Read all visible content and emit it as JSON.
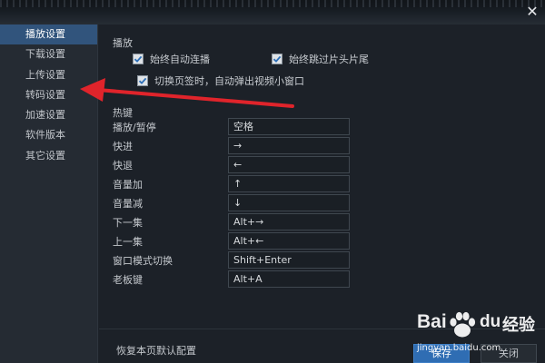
{
  "window": {
    "close_icon": "close-icon"
  },
  "sidebar": {
    "items": [
      {
        "label": "播放设置",
        "active": true
      },
      {
        "label": "下载设置",
        "active": false
      },
      {
        "label": "上传设置",
        "active": false
      },
      {
        "label": "转码设置",
        "active": false
      },
      {
        "label": "加速设置",
        "active": false
      },
      {
        "label": "软件版本",
        "active": false
      },
      {
        "label": "其它设置",
        "active": false
      }
    ]
  },
  "playback": {
    "section_title": "播放",
    "options": [
      {
        "label": "始终自动连播",
        "checked": true
      },
      {
        "label": "始终跳过片头片尾",
        "checked": true
      },
      {
        "label": "切换页签时，自动弹出视频小窗口",
        "checked": true
      }
    ]
  },
  "hotkeys": {
    "section_title": "热键",
    "rows": [
      {
        "label": "播放/暂停",
        "value": "空格"
      },
      {
        "label": "快进",
        "value": "→"
      },
      {
        "label": "快退",
        "value": "←"
      },
      {
        "label": "音量加",
        "value": "↑"
      },
      {
        "label": "音量减",
        "value": "↓"
      },
      {
        "label": "下一集",
        "value": "Alt+→"
      },
      {
        "label": "上一集",
        "value": "Alt+←"
      },
      {
        "label": "窗口模式切换",
        "value": "Shift+Enter"
      },
      {
        "label": "老板键",
        "value": "Alt+A"
      }
    ]
  },
  "footer": {
    "restore_label": "恢复本页默认配置",
    "save_label": "保存",
    "close_label": "关闭"
  },
  "watermark": {
    "brand": "Bai",
    "brand_suffix": "du",
    "brand_cn": "经验",
    "url": "jingyan.baidu.com"
  },
  "colors": {
    "accent": "#31547c",
    "save_button": "#2f6db3",
    "annotation_arrow": "#e0242b"
  }
}
